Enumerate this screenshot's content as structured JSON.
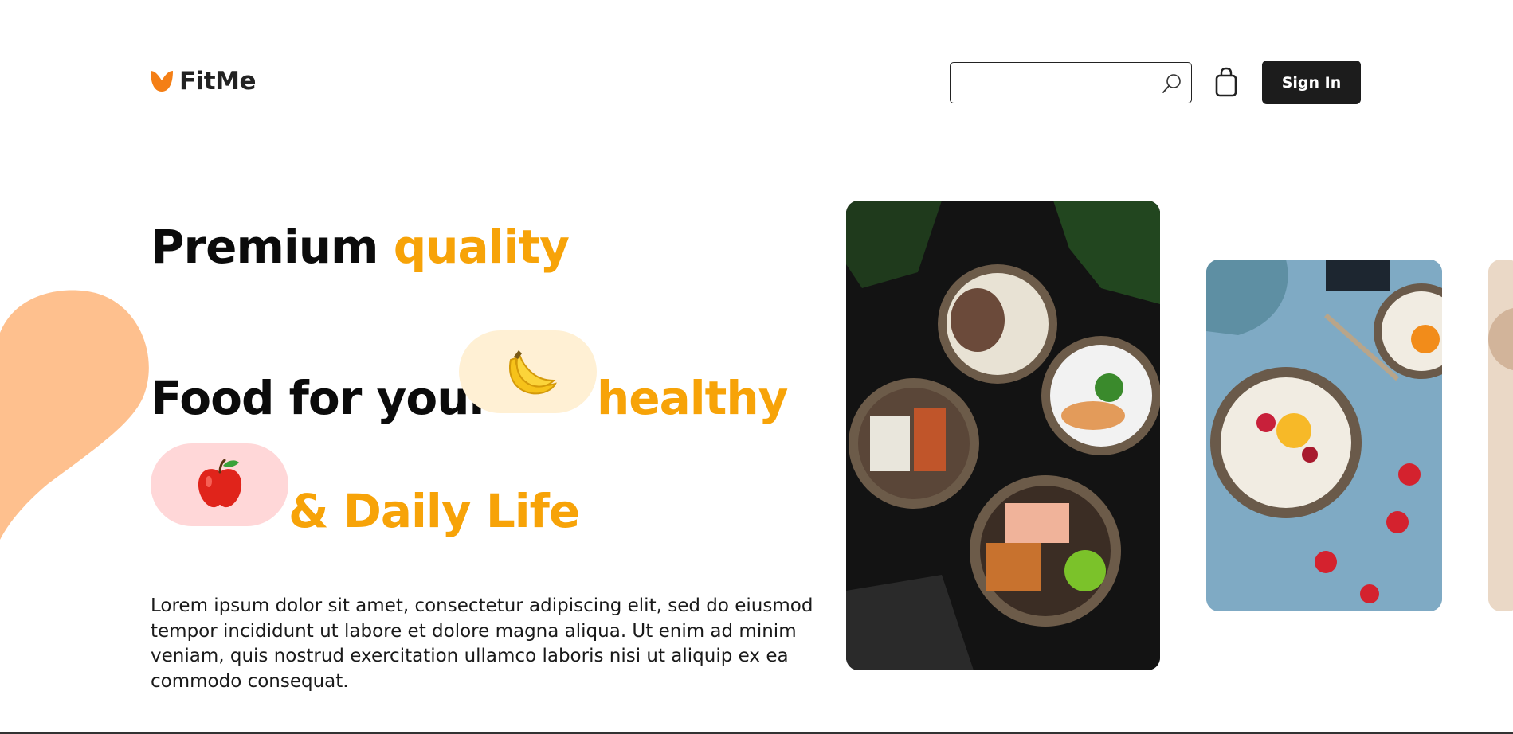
{
  "brand": {
    "name": "FitMe",
    "accent_color": "#f7a308",
    "logo_color": "#f47f16"
  },
  "header": {
    "search": {
      "value": "",
      "placeholder": ""
    },
    "icons": {
      "search": "search-icon",
      "cart": "shopping-bag-icon"
    },
    "signin_label": "Sign In"
  },
  "hero": {
    "line1": {
      "dark": "Premium",
      "accent": "quality"
    },
    "line2": {
      "dark": "Food for your",
      "accent": "healthy"
    },
    "line3": {
      "accent": "& Daily Life"
    },
    "emoji_1": "🍌",
    "emoji_2": "🍎",
    "description": "Lorem ipsum dolor sit amet, consectetur adipiscing elit, sed do eiusmod tempor incididunt ut labore et dolore magna aliqua. Ut enim ad minim veniam, quis nostrud exercitation ullamco laboris nisi ut aliquip ex ea commodo consequat."
  },
  "gallery": {
    "cards": [
      {
        "name": "meal-bowls-photo"
      },
      {
        "name": "oatmeal-fruit-photo"
      },
      {
        "name": "partial-photo"
      }
    ]
  }
}
